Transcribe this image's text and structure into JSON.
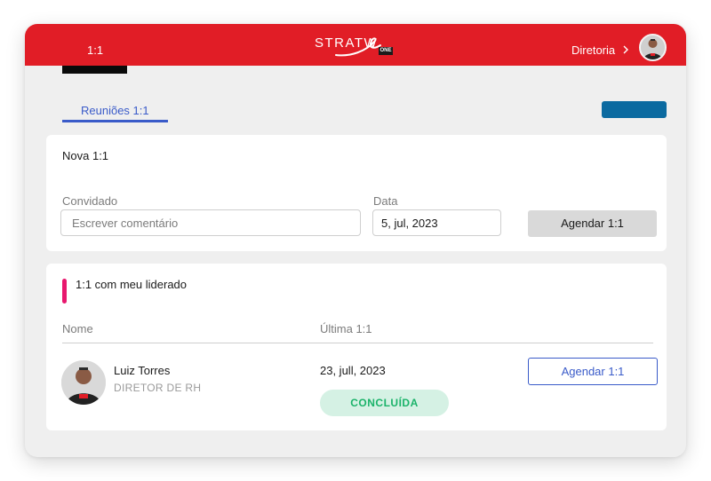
{
  "header": {
    "breadcrumb": "1:1",
    "logo_text": "STRATW",
    "logo_badge": "ONE",
    "role_label": "Diretoria",
    "color": "#e11d26"
  },
  "tabs": [
    {
      "label": "Reuniões 1:1",
      "active": true
    }
  ],
  "new_meeting": {
    "title": "Nova 1:1",
    "guest_label": "Convidado",
    "guest_placeholder": "Escrever comentário",
    "date_label": "Data",
    "date_value": "5, jul, 2023",
    "schedule_button": "Agendar 1:1"
  },
  "led_meetings": {
    "title": "1:1 com meu liderado",
    "columns": [
      "Nome",
      "Última 1:1"
    ],
    "rows": [
      {
        "name": "Luiz Torres",
        "role": "DIRETOR DE RH",
        "last_date": "23, jull, 2023",
        "status": "CONCLUÍDA",
        "action": "Agendar 1:1"
      }
    ]
  },
  "colors": {
    "accent_blue": "#3a5bc9",
    "status_green": "#1bb36a",
    "brand_red": "#e11d26",
    "marker_pink": "#e8186e"
  }
}
